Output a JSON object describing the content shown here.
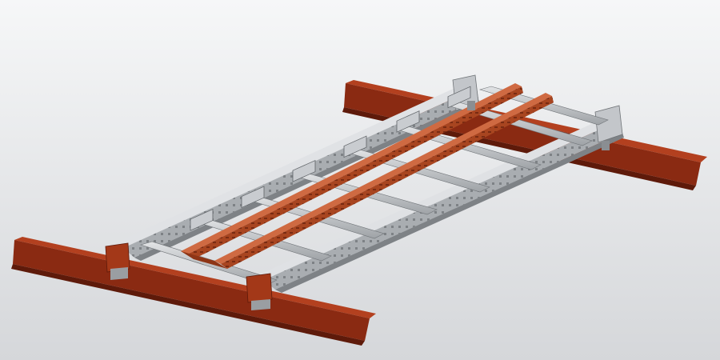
{
  "scene": {
    "background_top": "#f4f5f6",
    "background_bottom": "#d7d9dc",
    "colors": {
      "red_beam": "#8a2a12",
      "red_beam_light": "#b3401f",
      "red_beam_dark": "#5e1a0a",
      "red_rail": "#b6532d",
      "red_rail_light": "#cf6a42",
      "red_rail_holes": "#7a2c12",
      "steel": "#b9bcc0",
      "steel_light": "#d9dcdf",
      "steel_dark": "#7e8286",
      "steel_holes": "#55595d"
    },
    "objects": [
      "support-i-beam-front",
      "support-i-beam-back",
      "left-side-rail",
      "right-side-rail",
      "cross-members",
      "center-red-rails",
      "mounting-clamps"
    ]
  }
}
